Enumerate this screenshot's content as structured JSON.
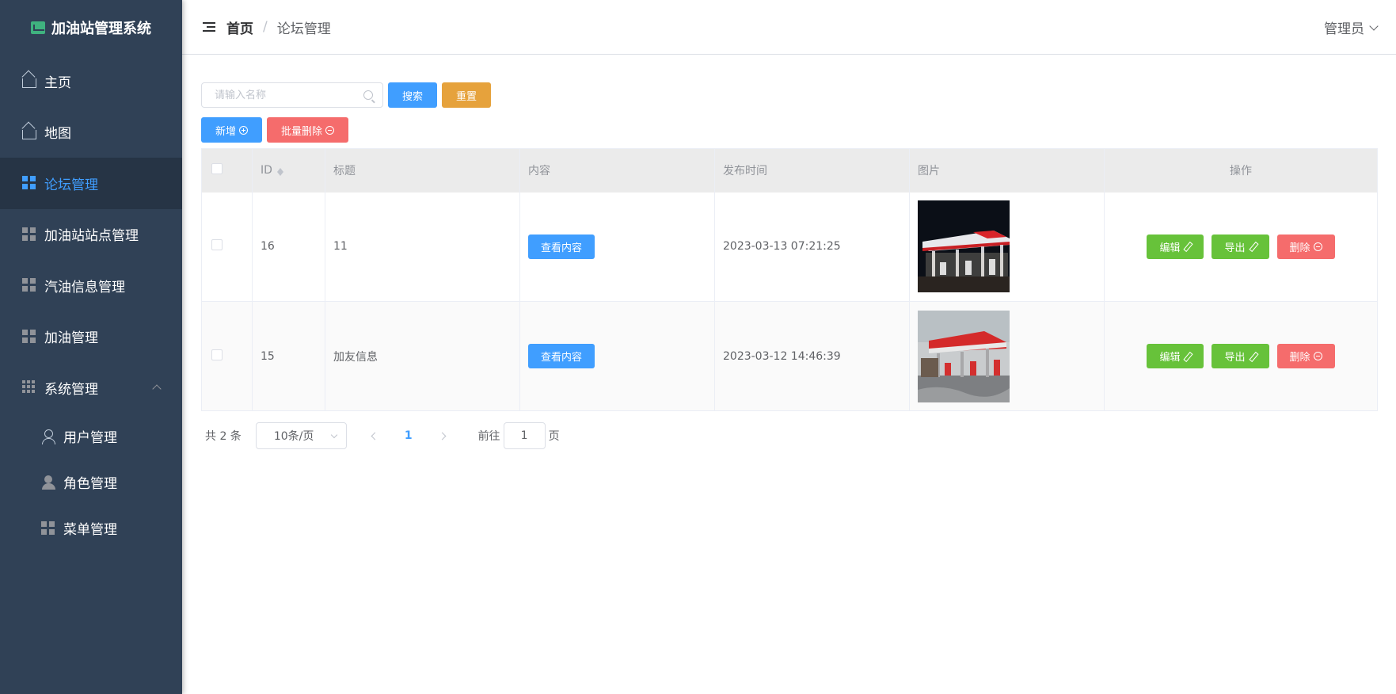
{
  "app": {
    "title": "加油站管理系统"
  },
  "sidebar": {
    "items": [
      {
        "label": "主页",
        "icon": "home-icon"
      },
      {
        "label": "地图",
        "icon": "home-icon"
      },
      {
        "label": "论坛管理",
        "icon": "grid-icon",
        "active": true
      },
      {
        "label": "加油站站点管理",
        "icon": "grid-icon"
      },
      {
        "label": "汽油信息管理",
        "icon": "grid-icon"
      },
      {
        "label": "加油管理",
        "icon": "grid-icon"
      },
      {
        "label": "系统管理",
        "icon": "apps-icon",
        "expanded": true
      }
    ],
    "sub_items": [
      {
        "label": "用户管理",
        "icon": "user-icon"
      },
      {
        "label": "角色管理",
        "icon": "user-filled-icon"
      },
      {
        "label": "菜单管理",
        "icon": "grid-icon"
      }
    ]
  },
  "header": {
    "breadcrumb": {
      "home": "首页",
      "separator": "/",
      "current": "论坛管理"
    },
    "user": "管理员"
  },
  "toolbar": {
    "search_placeholder": "请输入名称",
    "search_label": "搜索",
    "reset_label": "重置",
    "add_label": "新增",
    "batch_delete_label": "批量删除"
  },
  "table": {
    "columns": [
      "ID",
      "标题",
      "内容",
      "发布时间",
      "图片",
      "操作"
    ],
    "rows": [
      {
        "id": "16",
        "title": "11",
        "content_button": "查看内容",
        "time": "2023-03-13 07:21:25",
        "image": "gas-station-night"
      },
      {
        "id": "15",
        "title": "加友信息",
        "content_button": "查看内容",
        "time": "2023-03-12 14:46:39",
        "image": "gas-station-day"
      }
    ],
    "actions": {
      "edit": "编辑",
      "export": "导出",
      "delete": "删除"
    }
  },
  "pagination": {
    "total": "共 2 条",
    "page_size": "10条/页",
    "current_page": "1",
    "goto_prefix": "前往",
    "goto_value": "1",
    "goto_suffix": "页"
  },
  "colors": {
    "sidebar_bg": "#304156",
    "accent": "#409eff",
    "warning": "#e6a23c",
    "danger": "#f56c6c",
    "success": "#67c23a"
  }
}
